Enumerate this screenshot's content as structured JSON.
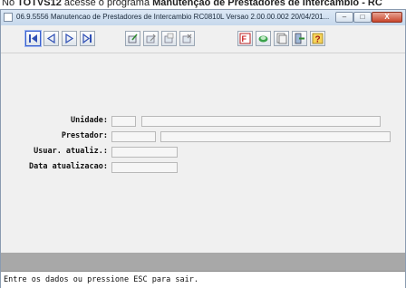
{
  "document": {
    "text_prefix": "No ",
    "text_bold_1": "TOTVS12",
    "text_middle": " acesse o programa ",
    "text_bold_2": "Manutenção de Prestadores de Intercâmbio - RC"
  },
  "window": {
    "title": "06.9.5556 Manutencao de Prestadores de Intercambio RC0810L Versao 2.00.00.002 20/04/201...",
    "minimize_label": "–",
    "maximize_label": "□",
    "close_label": "X"
  },
  "toolbar": {
    "icons": [
      "first-record-icon",
      "previous-record-icon",
      "next-record-icon",
      "last-record-icon",
      "add-record-icon",
      "edit-record-icon",
      "copy-record-icon",
      "delete-record-icon",
      "filter-icon",
      "search-icon",
      "report-icon",
      "exit-icon",
      "help-icon"
    ]
  },
  "form": {
    "unidade_label": "Unidade:",
    "prestador_label": "Prestador:",
    "usuar_label": "Usuar. atualiz.:",
    "data_label": "Data atualizacao:",
    "unidade_code": "",
    "unidade_name": "",
    "prestador_code": "",
    "prestador_name": "",
    "usuar_value": "",
    "data_value": ""
  },
  "status_bar": {
    "message": "Entre os dados ou pressione ESC para sair."
  }
}
